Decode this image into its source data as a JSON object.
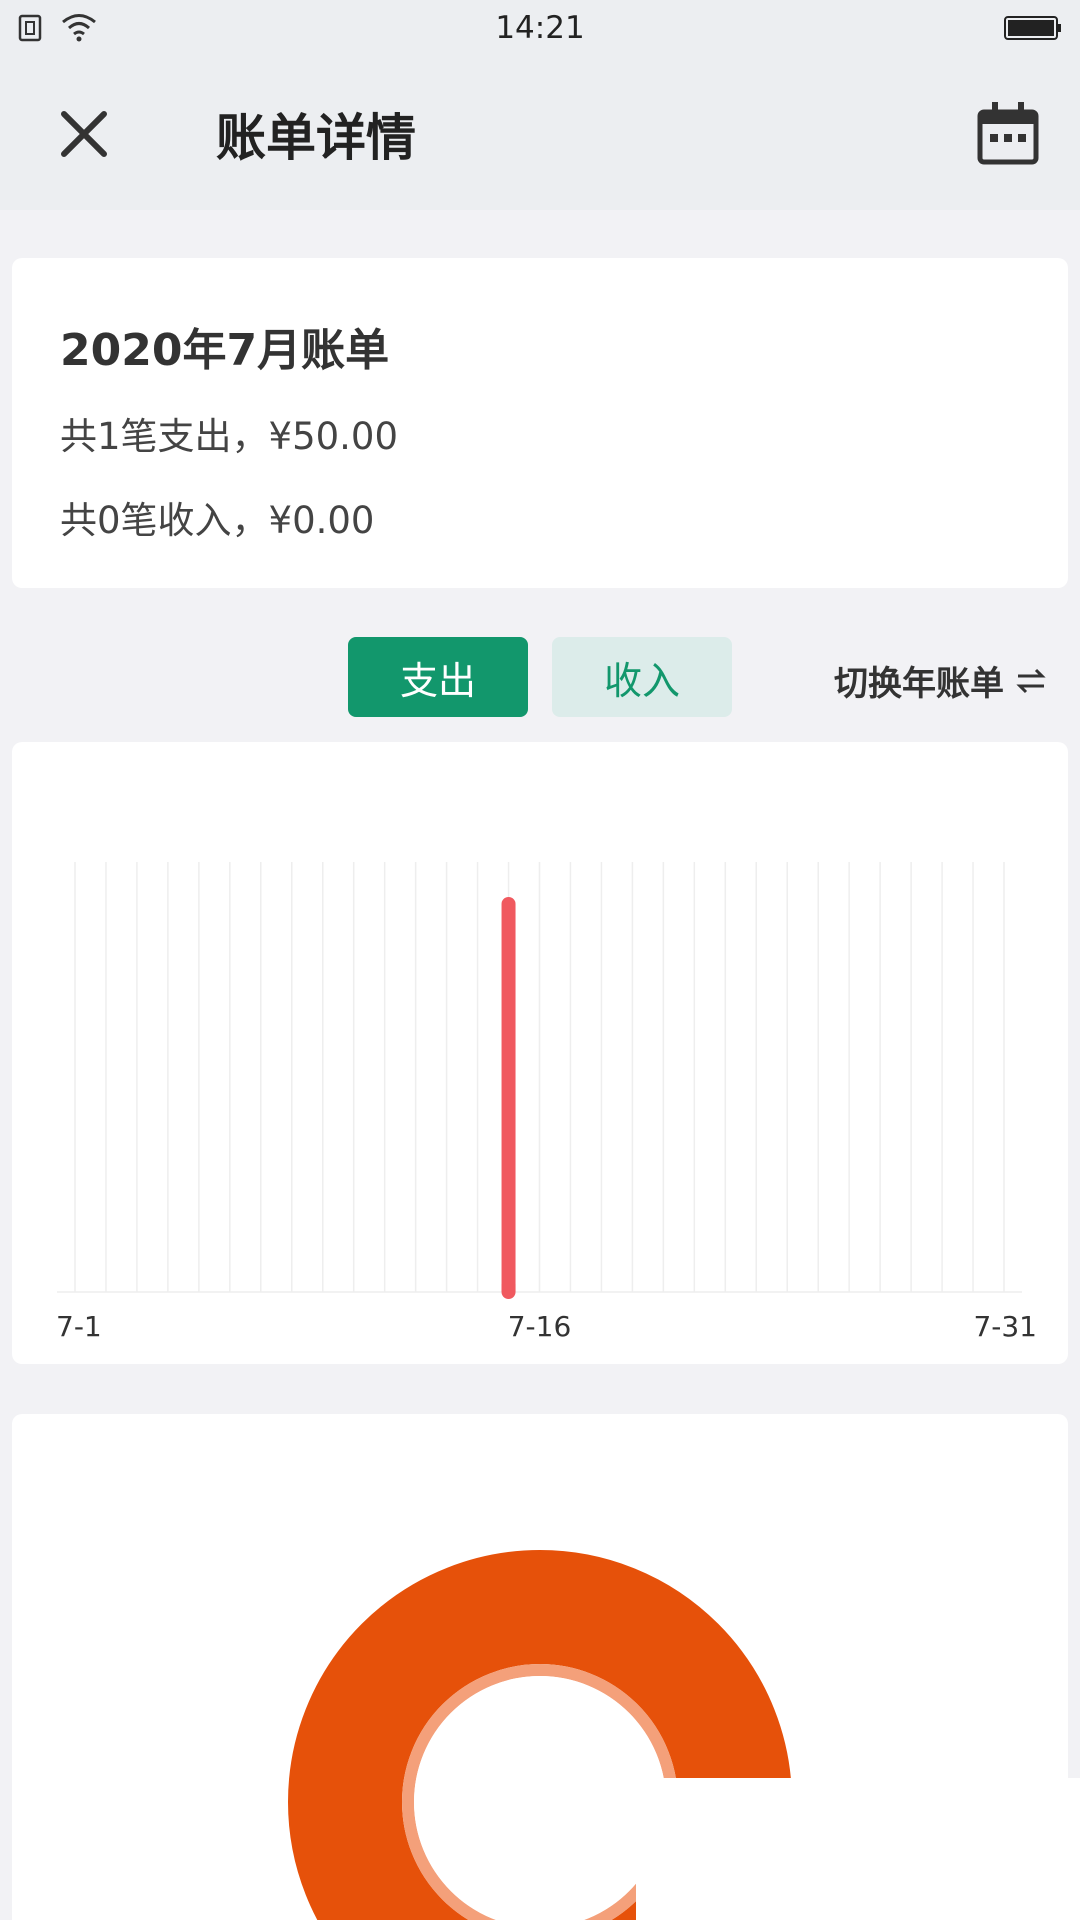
{
  "status_bar": {
    "time": "14:21"
  },
  "header": {
    "title": "账单详情"
  },
  "summary": {
    "month_title": "2020年7月账单",
    "expense_line": "共1笔支出，¥50.00",
    "income_line": "共0笔收入，¥0.00"
  },
  "tabs": {
    "expense": "支出",
    "income": "收入",
    "switch_year": "切换年账单"
  },
  "colors": {
    "accent": "#12976c",
    "bar": "#f0595f",
    "donut": "#e6510a",
    "donut_ring": "#f4a07a"
  },
  "chart_data": [
    {
      "type": "bar",
      "x": [
        "7-1",
        "7-2",
        "7-3",
        "7-4",
        "7-5",
        "7-6",
        "7-7",
        "7-8",
        "7-9",
        "7-10",
        "7-11",
        "7-12",
        "7-13",
        "7-14",
        "7-15",
        "7-16",
        "7-17",
        "7-18",
        "7-19",
        "7-20",
        "7-21",
        "7-22",
        "7-23",
        "7-24",
        "7-25",
        "7-26",
        "7-27",
        "7-28",
        "7-29",
        "7-30",
        "7-31"
      ],
      "values": [
        0,
        0,
        0,
        0,
        0,
        0,
        0,
        0,
        0,
        0,
        0,
        0,
        0,
        0,
        50,
        0,
        0,
        0,
        0,
        0,
        0,
        0,
        0,
        0,
        0,
        0,
        0,
        0,
        0,
        0,
        0
      ],
      "tick_labels": [
        "7-1",
        "7-16",
        "7-31"
      ],
      "grid": true
    },
    {
      "type": "pie",
      "values": [
        50
      ]
    }
  ],
  "icons": [
    "close-icon",
    "calendar-icon",
    "swap-icon",
    "sim-icon",
    "wifi-icon",
    "battery-icon"
  ]
}
